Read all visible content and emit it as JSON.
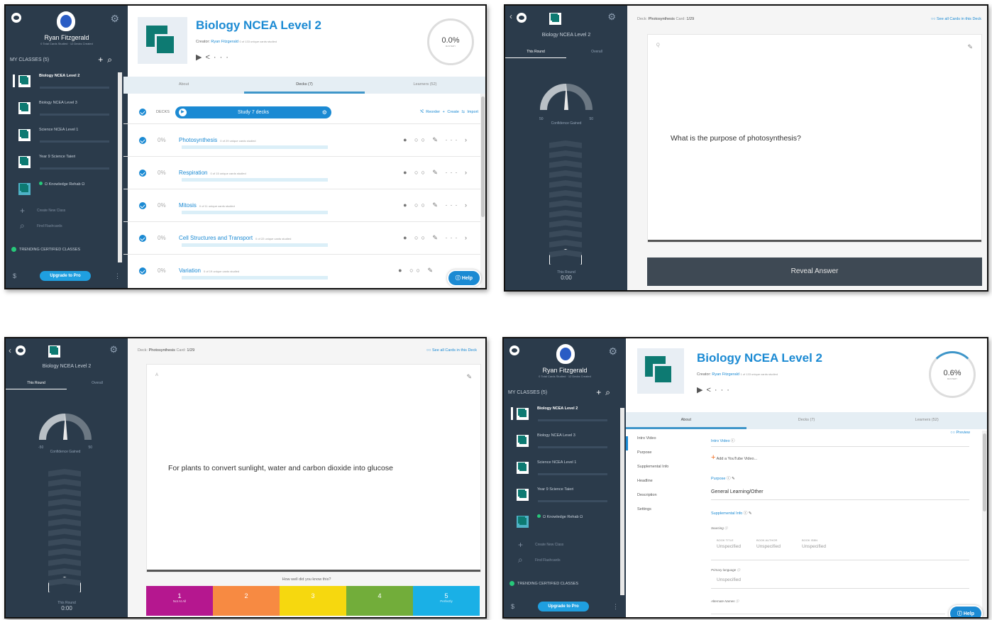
{
  "user": {
    "name": "Ryan Fitzgerald",
    "stats": "0 Total Cards Studied · 12 Decks Created"
  },
  "sidebar": {
    "my_classes": "MY CLASSES (5)",
    "my_classes_p4": "MY CLASSES (5)",
    "classes": [
      {
        "name": "Biology NCEA Level 2"
      },
      {
        "name": "Biology NCEA Level 3"
      },
      {
        "name": "Science NCEA Level 1"
      },
      {
        "name": "Year 9 Science Taieri"
      },
      {
        "name": "Ω Knowledge Rehab Ω"
      }
    ],
    "create_class": "Create New Class",
    "find_flashcards": "Find Flashcards",
    "trending": "TRENDING CERTIFIED CLASSES",
    "upgrade": "Upgrade to Pro",
    "dollar": "$"
  },
  "course": {
    "title": "Biology NCEA Level 2",
    "creator_label": "Creator:",
    "creator": "Ryan Fitzgerald",
    "studied_p1": "0 of 133 unique cards studied",
    "studied_p4": "1 of 133 unique cards studied",
    "mastery_p1": "0.0%",
    "mastery_p4": "0.6%",
    "mastery_label": "MASTERY"
  },
  "tabs": {
    "about": "About",
    "decks": "Decks (7)",
    "learners": "Learners (52)"
  },
  "decks_header": {
    "label": "DECKS",
    "study": "Study 7 decks",
    "reorder": "Reorder",
    "create": "Create",
    "import": "Import"
  },
  "decks": [
    {
      "name": "Photosynthesis",
      "pct": "0%",
      "studied": "0 of 29 unique cards studied"
    },
    {
      "name": "Respiration",
      "pct": "0%",
      "studied": "0 of 15 unique cards studied"
    },
    {
      "name": "Mitosis",
      "pct": "0%",
      "studied": "0 of 11 unique cards studied"
    },
    {
      "name": "Cell Structures and Transport",
      "pct": "0%",
      "studied": "0 of 22 unique cards studied"
    },
    {
      "name": "Variation",
      "pct": "0%",
      "studied": "0 of 19 unique cards studied"
    }
  ],
  "help": "Help",
  "study": {
    "class_title": "Biology NCEA Level 2",
    "this_round": "This Round",
    "overall": "Overall",
    "gauge_min": "-50",
    "gauge_max": "50",
    "gauge_min_p2": "50",
    "gauge_label": "Confidence Gained",
    "round_label": "This Round",
    "round_time": "0:00",
    "deck_label": "Deck:",
    "deck_name": "Photosynthesis",
    "card_label": "Card:",
    "card_num": "1/29",
    "see_all": "See all Cards in this Deck",
    "q_marker": "Q",
    "a_marker": "A",
    "question": "What is the purpose of photosynthesis?",
    "answer": "For plants to convert sunlight, water and carbon dioxide into glucose",
    "reveal": "Reveal Answer",
    "how_well": "How well did you know this?",
    "ratings": [
      {
        "n": "1",
        "sub": "Not At All",
        "color": "#b5178f"
      },
      {
        "n": "2",
        "sub": "",
        "color": "#f78a42"
      },
      {
        "n": "3",
        "sub": "",
        "color": "#f6d80f"
      },
      {
        "n": "4",
        "sub": "",
        "color": "#72ad3a"
      },
      {
        "n": "5",
        "sub": "Perfectly",
        "color": "#1ab0e6"
      }
    ]
  },
  "about": {
    "nav": [
      "Intro Video",
      "Purpose",
      "Supplemental Info",
      "Headline",
      "Description",
      "Settings"
    ],
    "preview": "Preview",
    "intro_label": "Intro Video",
    "add_video": "Add a YouTube Video...",
    "purpose_label": "Purpose",
    "purpose_val": "General Learning/Other",
    "supp_label": "Supplemental Info",
    "sourcing": "Sourcing",
    "src_cols": [
      {
        "h": "BOOK TITLE",
        "v": "Unspecified"
      },
      {
        "h": "BOOK AUTHOR",
        "v": "Unspecified"
      },
      {
        "h": "BOOK ISBN",
        "v": "Unspecified"
      }
    ],
    "primary_lang": "Primary language",
    "primary_val": "Unspecified",
    "alt_names": "Alternate Names"
  }
}
